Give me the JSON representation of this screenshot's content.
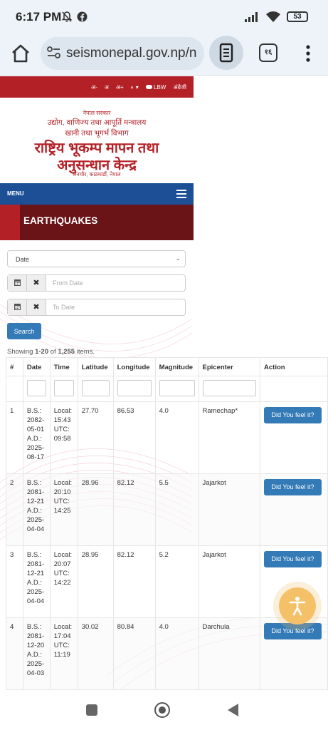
{
  "status_bar": {
    "time": "6:17 PM",
    "battery": "53",
    "icons": [
      "mute-bell-icon",
      "facebook-icon",
      "signal-icon",
      "wifi-icon",
      "battery-icon"
    ]
  },
  "browser": {
    "url": "seismonepal.gov.np/n",
    "tab_count": "१६"
  },
  "site": {
    "topbar": {
      "font_small": "अ-",
      "font_normal": "अ",
      "font_large": "अ+",
      "contrast": "◐ ▾",
      "lbw": "LBW",
      "language": "अंग्रेजी"
    },
    "header": {
      "line1": "नेपाल सरकार",
      "line2": "उद्योग, वाणिज्य तथा आपूर्ति मन्त्रालय",
      "line3": "खानी तथा भूगर्भ विभाग",
      "title_line1": "राष्ट्रिय भूकम्प मापन तथा",
      "title_line2": "अनुसन्धान केन्द्र",
      "address": "लैनचौर, काठमाडौं, नेपाल"
    },
    "menu_label": "MENU",
    "page_title": "EARTHQUAKES",
    "brand_colors": {
      "red": "#b32127",
      "dark_red": "#6b1418",
      "blue": "#1c4f96",
      "button_blue": "#337ab7"
    }
  },
  "filters": {
    "date_type": "Date",
    "from_placeholder": "From Date",
    "to_placeholder": "To Date",
    "search_label": "Search"
  },
  "summary": {
    "prefix": "Showing ",
    "range": "1-20",
    "middle": " of ",
    "total": "1,255",
    "suffix": " items."
  },
  "table": {
    "headers": [
      "#",
      "Date",
      "Time",
      "Latitude",
      "Longitude",
      "Magnitude",
      "Epicenter",
      "Action"
    ],
    "rows": [
      {
        "num": "1",
        "date_bs": "B.S.: 2082-05-01",
        "date_ad": "A.D.: 2025-08-17",
        "time_local": "Local: 15:43",
        "time_utc": "UTC: 09:58",
        "lat": "27.70",
        "lon": "86.53",
        "mag": "4.0",
        "epicenter": "Ramechap*",
        "action": "Did You feel it?"
      },
      {
        "num": "2",
        "date_bs": "B.S.: 2081-12-21",
        "date_ad": "A.D.: 2025-04-04",
        "time_local": "Local: 20:10",
        "time_utc": "UTC: 14:25",
        "lat": "28.96",
        "lon": "82.12",
        "mag": "5.5",
        "epicenter": "Jajarkot",
        "action": "Did You feel it?"
      },
      {
        "num": "3",
        "date_bs": "B.S.: 2081-12-21",
        "date_ad": "A.D.: 2025-04-04",
        "time_local": "Local: 20:07",
        "time_utc": "UTC: 14:22",
        "lat": "28.95",
        "lon": "82.12",
        "mag": "5.2",
        "epicenter": "Jajarkot",
        "action": "Did You feel it?"
      },
      {
        "num": "4",
        "date_bs": "B.S.: 2081-12-20",
        "date_ad": "A.D.: 2025-04-03",
        "time_local": "Local: 17:04",
        "time_utc": "UTC: 11:19",
        "lat": "30.02",
        "lon": "80.84",
        "mag": "4.0",
        "epicenter": "Darchula",
        "action": "Did You feel it?"
      }
    ]
  }
}
